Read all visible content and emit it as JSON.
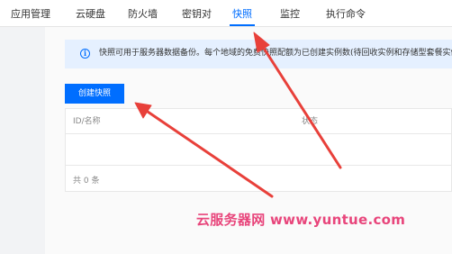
{
  "tabs": [
    {
      "label": "应用管理",
      "active": false
    },
    {
      "label": "云硬盘",
      "active": false
    },
    {
      "label": "防火墙",
      "active": false
    },
    {
      "label": "密钥对",
      "active": false
    },
    {
      "label": "快照",
      "active": true
    },
    {
      "label": "监控",
      "active": false
    },
    {
      "label": "执行命令",
      "active": false
    }
  ],
  "notice": {
    "icon": "info-icon",
    "text": "快照可用于服务器数据备份。每个地域的免费快照配额为已创建实例数(待回收实例和存储型套餐实例"
  },
  "toolbar": {
    "create_label": "创建快照"
  },
  "table": {
    "columns": [
      "ID/名称",
      "状态"
    ],
    "footer": "共 0 条"
  },
  "watermark": "云服务器网 www.yuntue.com",
  "colors": {
    "accent": "#006eff",
    "notice_bg": "#e5f0ff",
    "arrow": "#e8403a",
    "watermark": "#e8457b"
  }
}
